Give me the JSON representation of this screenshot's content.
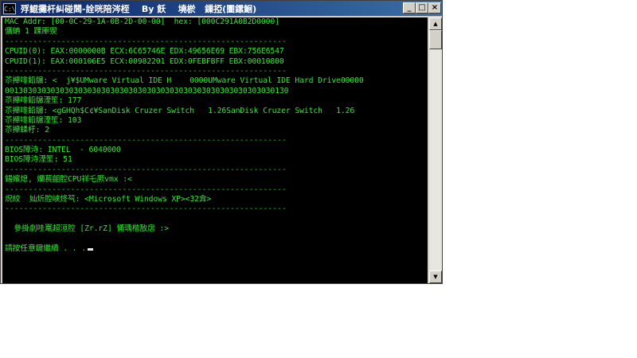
{
  "window": {
    "icon_label": "C:\\",
    "title": "殍鯤攤杆糾碰閪-詮咣陪涔桎    By 飫    墝棜   鏁掗(圕鏍鮰)",
    "minimize": "_",
    "maximize": "□",
    "close": "×"
  },
  "console": {
    "lines": [
      "MAC Addr: [00-0C-29-1A-0B-2D-00-00]  hex: [000C291A0B2D0000]",
      "儣蚺 1 踝厙猰",
      "------------------------------------------------------------",
      "CPUID(0): EAX:0000000B ECX:6C65746E EDX:49656E69 EBX:756E6547",
      "CPUID(1): EAX:000106E5 ECX:00982201 EDX:0FEBFBFF EBX:00010800",
      "------------------------------------------------------------",
      "苶攑啡鉛牖: <  j¥$UMware Virtual IDE H    0000UMware Virtual IDE Hard Drive00000",
      "00130303030303030303030303030303030303030303030303030303030130",
      "苶攑啡鉛牖湮笙: 177",
      "苶攑啡鉛牖: <gGHQh$C¢¥SanDisk Cruzer Switch   1.26SanDisk Cruzer Switch   1.26",
      "苶攑啡鉛牖湮笙: 103",
      "苶攑鍒杅: 2",
      "------------------------------------------------------------",
      "BIOS障洔: INTEL  - 6040000",
      "BIOS障洔湮笙: 51",
      "------------------------------------------------------------",
      "鍚嬪熄, 孏萇齟腔CPU祥乇厥vmx :<",
      "------------------------------------------------------------",
      "炾絞  奾炘腔峽炵芞: <Microsoft Windows XP><32弇>",
      "------------------------------------------------------------",
      "",
      "  參掛劇哇鼍超洹腔 [Zr.rZ] 悀瑀楷敔扂 :>",
      "",
      "請按任意鍵繼續 . . ."
    ]
  }
}
